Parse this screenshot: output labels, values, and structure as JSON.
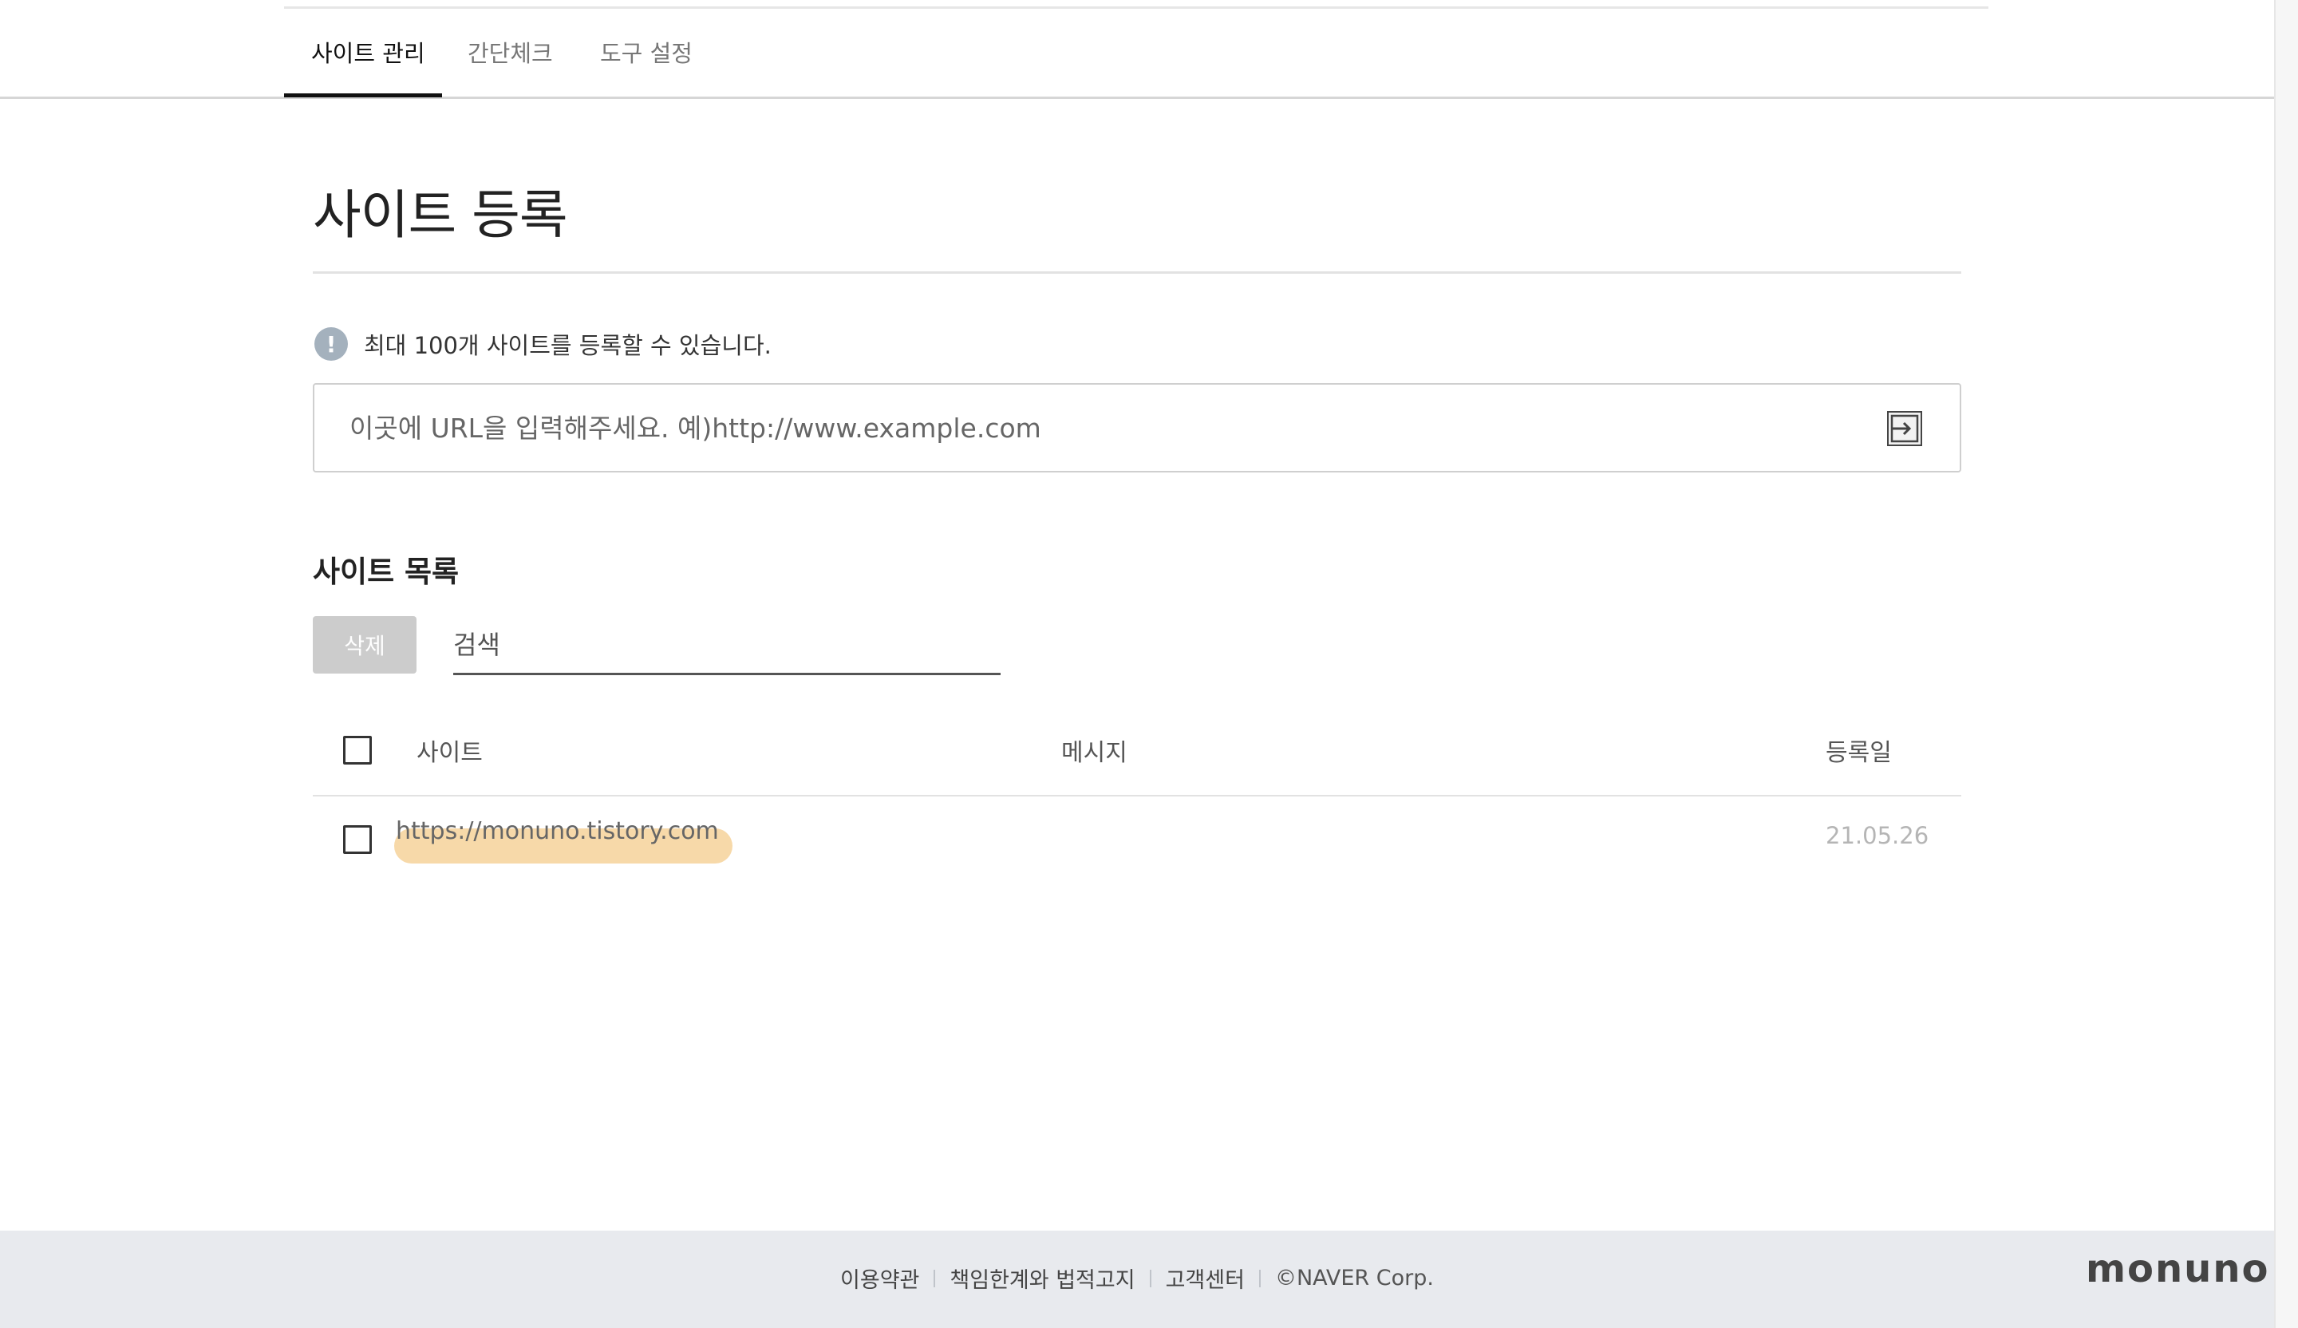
{
  "tabs": [
    {
      "label": "사이트 관리",
      "active": true
    },
    {
      "label": "간단체크",
      "active": false
    },
    {
      "label": "도구 설정",
      "active": false
    }
  ],
  "page": {
    "title": "사이트 등록",
    "notice": "최대 100개 사이트를 등록할 수 있습니다.",
    "url_input": {
      "value": "",
      "placeholder": "이곳에 URL을 입력해주세요. 예)http://www.example.com"
    }
  },
  "site_list": {
    "title": "사이트 목록",
    "delete_label": "삭제",
    "search": {
      "value": "",
      "placeholder": "검색"
    },
    "columns": {
      "site": "사이트",
      "message": "메시지",
      "date": "등록일"
    },
    "rows": [
      {
        "site": "https://monuno.tistory.com",
        "message": "",
        "date": "21.05.26",
        "checked": false
      }
    ]
  },
  "footer": {
    "links": [
      "이용약관",
      "책임한계와 법적고지",
      "고객센터"
    ],
    "copyright": "©NAVER Corp.",
    "brand": "monuno"
  },
  "colors": {
    "highlight": "#f7d9a9",
    "footer_bg": "#e8eaee",
    "info_icon": "#a4b1bd",
    "delete_button_bg": "#cccccc"
  },
  "icons": {
    "notice": "exclamation-circle-icon",
    "submit": "enter-arrow-icon"
  }
}
